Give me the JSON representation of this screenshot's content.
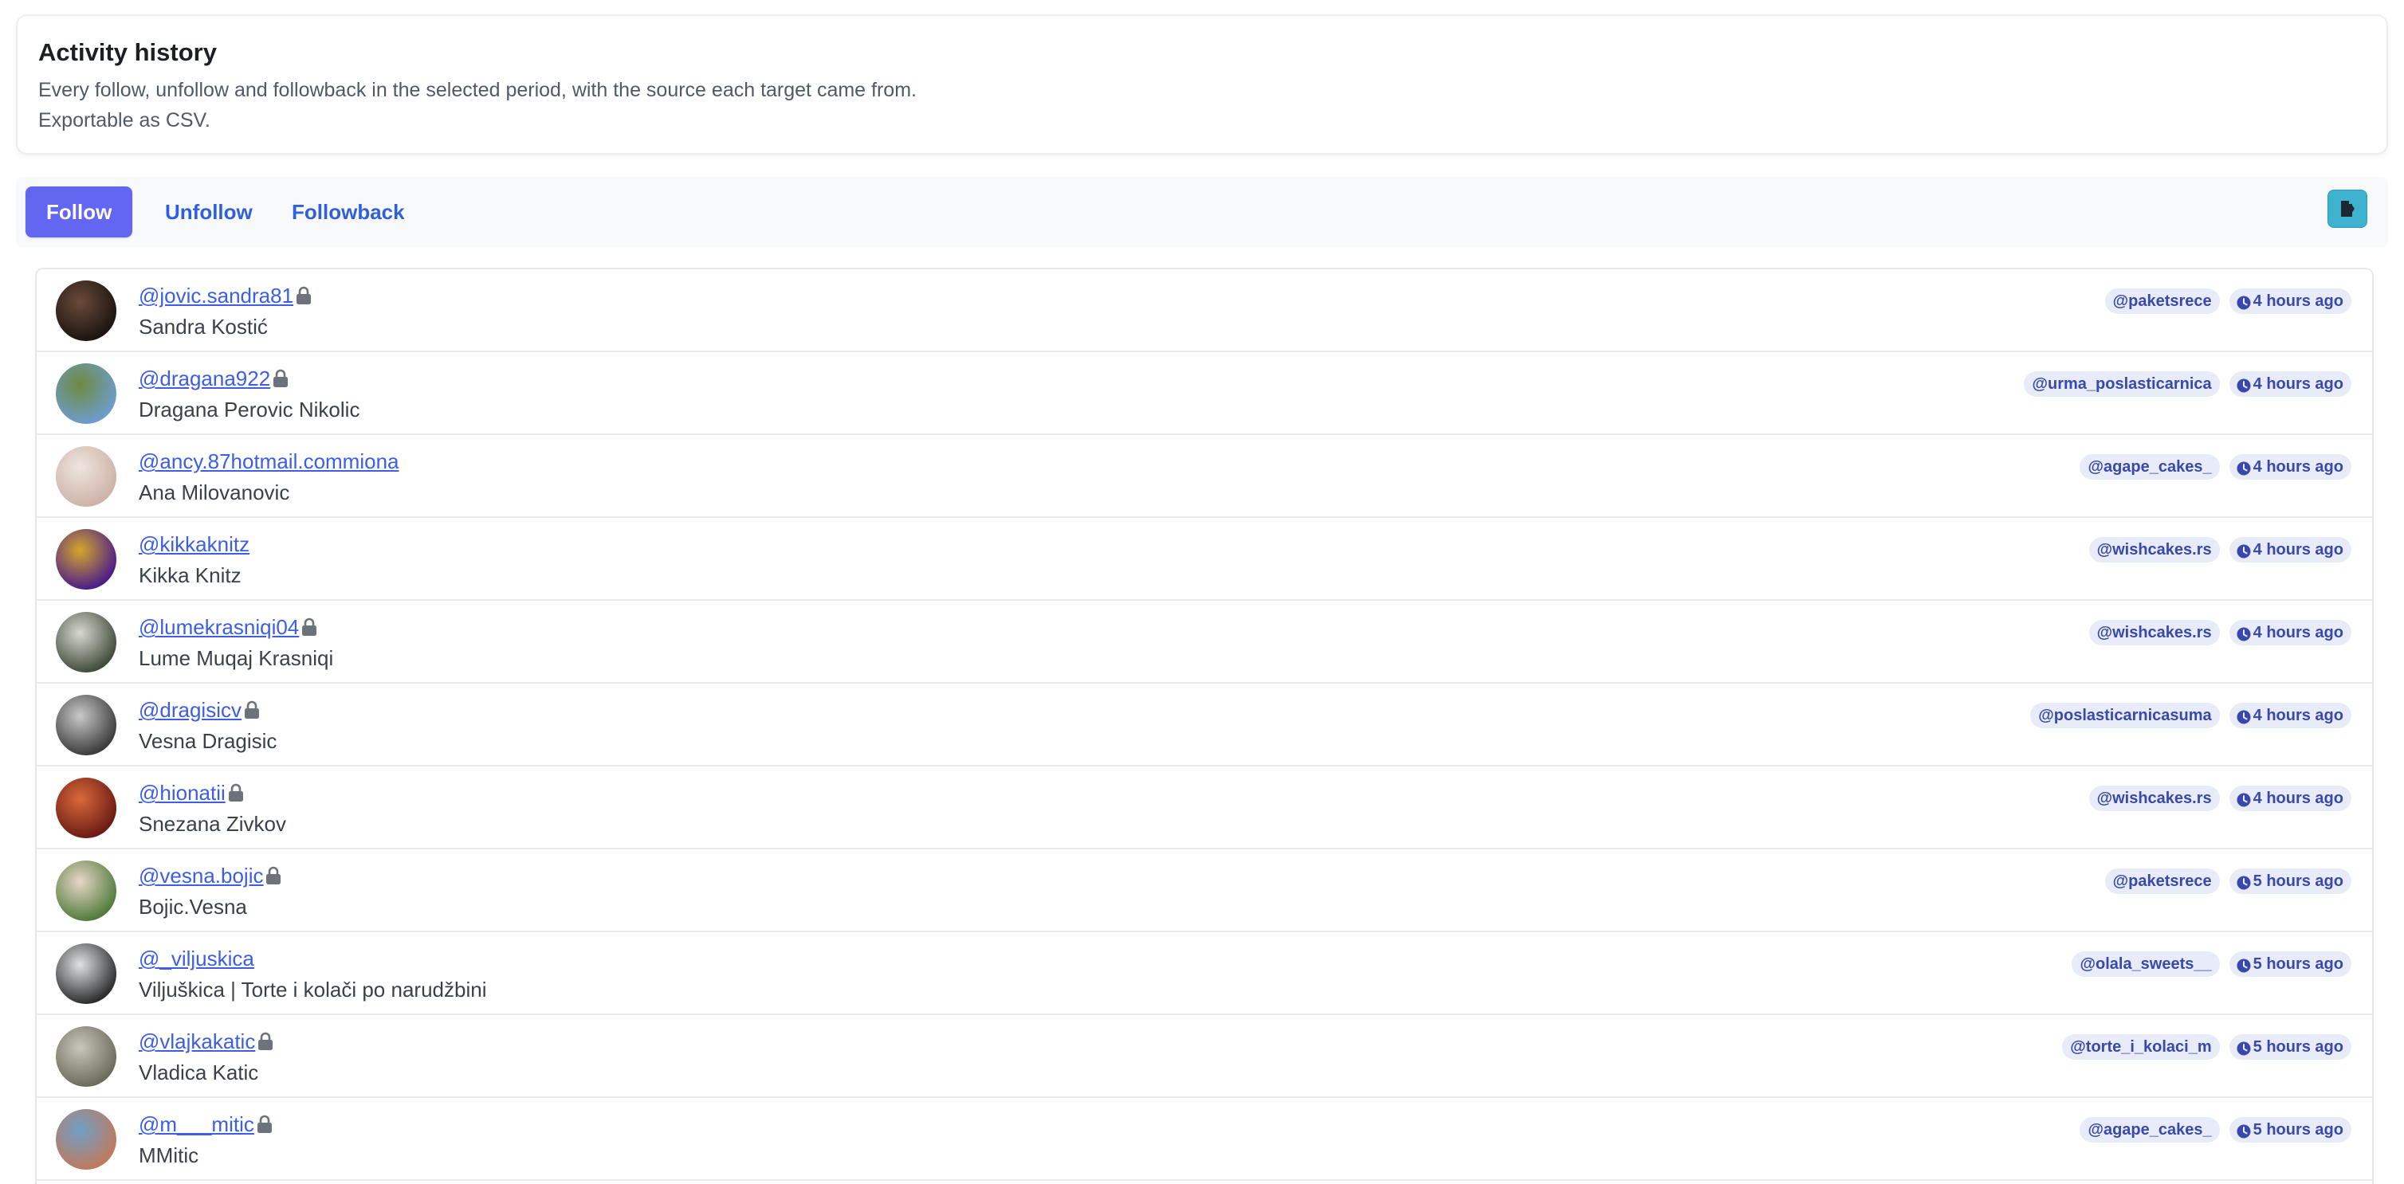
{
  "header": {
    "title": "Activity history",
    "description": "Every follow, unfollow and followback in the selected period, with the source each target came from. Exportable as CSV."
  },
  "tabs": {
    "follow": "Follow",
    "unfollow": "Unfollow",
    "followback": "Followback",
    "active": "Follow"
  },
  "export_button": {
    "icon": "export-csv-icon"
  },
  "colors": {
    "accent": "#6366f1",
    "link": "#3b5de7",
    "badge_bg": "#e8ebf8",
    "badge_text": "#3949ab",
    "export_btn": "#3fb2cf"
  },
  "rows": [
    {
      "handle": "@jovic.sandra81",
      "locked": true,
      "name": "Sandra Kostić",
      "source": "@paketsrece",
      "time": "4 hours ago",
      "avatar": [
        "#1b1410",
        "#6a4a3a"
      ]
    },
    {
      "handle": "@dragana922",
      "locked": true,
      "name": "Dragana Perovic Nikolic",
      "source": "@urma_poslasticarnica",
      "time": "4 hours ago",
      "avatar": [
        "#6d9dd0",
        "#6f8a3e"
      ]
    },
    {
      "handle": "@ancy.87hotmail.commiona",
      "locked": false,
      "name": "Ana Milovanovic",
      "source": "@agape_cakes_",
      "time": "4 hours ago",
      "avatar": [
        "#cdb2a6",
        "#eee5e0"
      ]
    },
    {
      "handle": "@kikkaknitz",
      "locked": false,
      "name": "Kikka Knitz",
      "source": "@wishcakes.rs",
      "time": "4 hours ago",
      "avatar": [
        "#4a1a8a",
        "#d4a72c"
      ]
    },
    {
      "handle": "@lumekrasniqi04",
      "locked": true,
      "name": "Lume Muqaj Krasniqi",
      "source": "@wishcakes.rs",
      "time": "4 hours ago",
      "avatar": [
        "#3e4a3a",
        "#d8d8cf"
      ]
    },
    {
      "handle": "@dragisicv",
      "locked": true,
      "name": "Vesna Dragisic",
      "source": "@poslasticarnicasuma",
      "time": "4 hours ago",
      "avatar": [
        "#3a3a3a",
        "#c9c9c9"
      ]
    },
    {
      "handle": "@hionatii",
      "locked": true,
      "name": "Snezana Zivkov",
      "source": "@wishcakes.rs",
      "time": "4 hours ago",
      "avatar": [
        "#6a1a14",
        "#d96a3a"
      ]
    },
    {
      "handle": "@vesna.bojic",
      "locked": true,
      "name": "Bojic.Vesna",
      "source": "@paketsrece",
      "time": "5 hours ago",
      "avatar": [
        "#4f7a3a",
        "#e8d6c8"
      ]
    },
    {
      "handle": "@_viljuskica",
      "locked": false,
      "name": "Viljuškica | Torte i kolači po narudžbini",
      "source": "@olala_sweets__",
      "time": "5 hours ago",
      "avatar": [
        "#2a2a2a",
        "#dfe3e6"
      ]
    },
    {
      "handle": "@vlajkakatic",
      "locked": true,
      "name": "Vladica Katic",
      "source": "@torte_i_kolaci_m",
      "time": "5 hours ago",
      "avatar": [
        "#6a6a5a",
        "#c9c6bd"
      ]
    },
    {
      "handle": "@m___mitic",
      "locked": true,
      "name": "MMitic",
      "source": "@agape_cakes_",
      "time": "5 hours ago",
      "avatar": [
        "#c07a5a",
        "#6fa0c8"
      ]
    }
  ]
}
